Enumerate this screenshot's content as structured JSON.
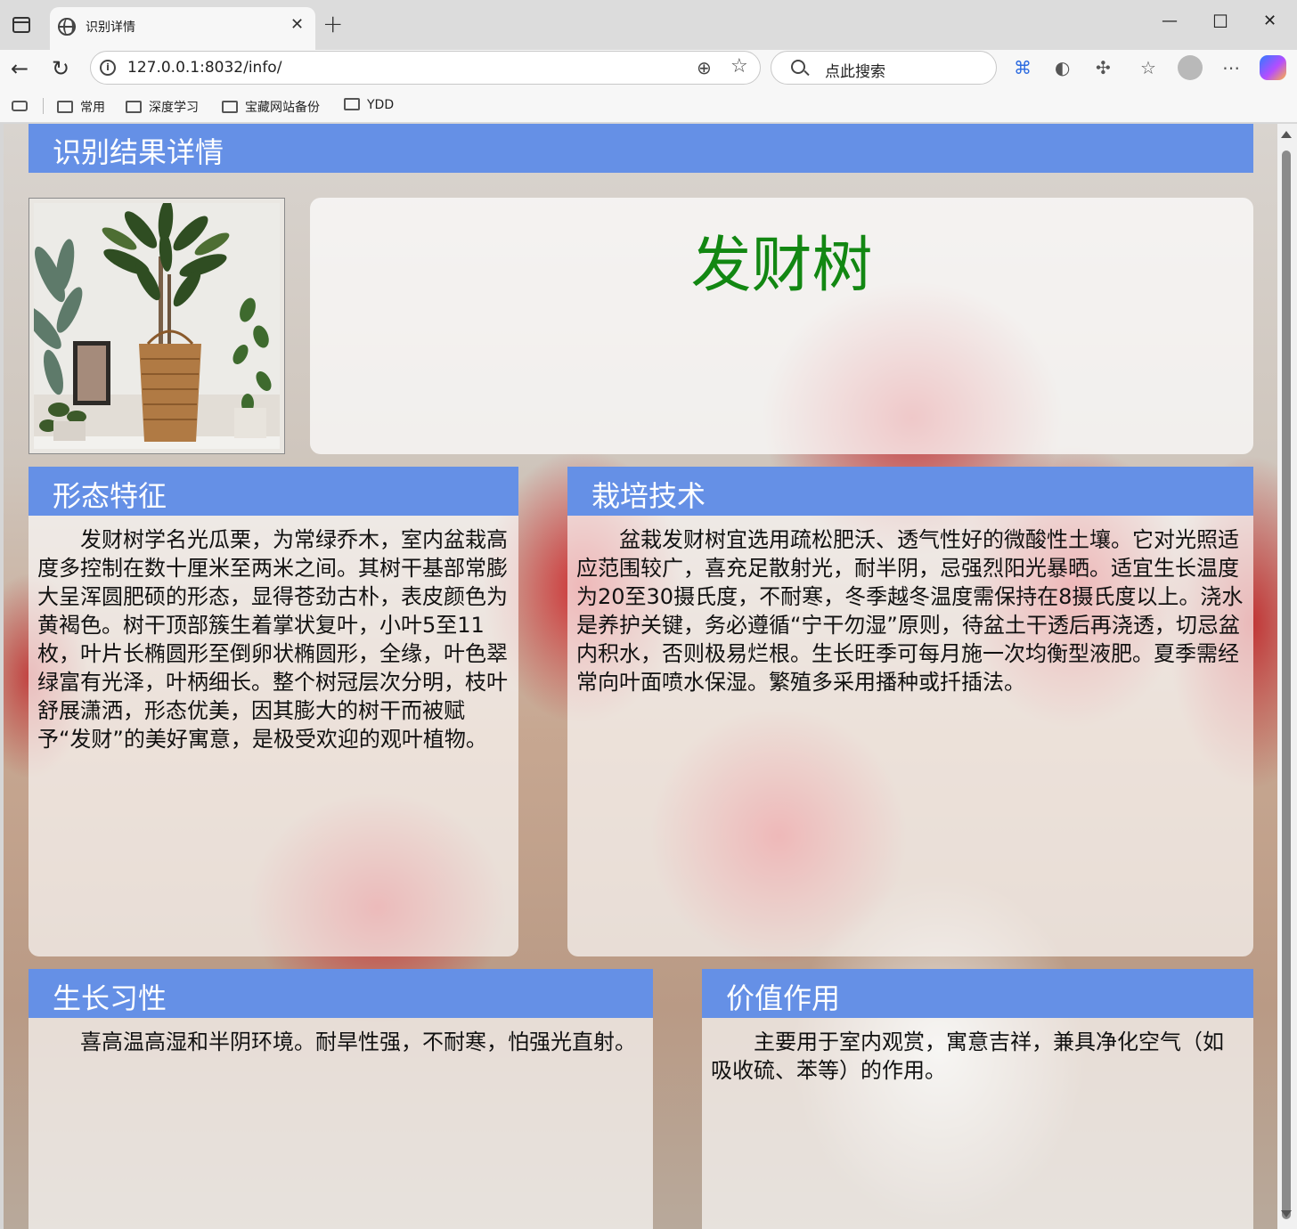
{
  "browser": {
    "tab_title": "识别详情",
    "url": "127.0.0.1:8032/info/",
    "search_placeholder": "点此搜索",
    "bookmarks": [
      "常用",
      "深度学习",
      "宝藏网站备份",
      "YDD"
    ]
  },
  "page": {
    "header_title": "识别结果详情",
    "plant_name": "发财树",
    "sections": {
      "morphology": {
        "title": "形态特征",
        "body": "发财树学名光瓜栗，为常绿乔木，室内盆栽高度多控制在数十厘米至两米之间。其树干基部常膨大呈浑圆肥硕的形态，显得苍劲古朴，表皮颜色为黄褐色。树干顶部簇生着掌状复叶，小叶5至11枚，叶片长椭圆形至倒卵状椭圆形，全缘，叶色翠绿富有光泽，叶柄细长。整个树冠层次分明，枝叶舒展潇洒，形态优美，因其膨大的树干而被赋予“发财”的美好寓意，是极受欢迎的观叶植物。"
      },
      "cultivation": {
        "title": "栽培技术",
        "body": "盆栽发财树宜选用疏松肥沃、透气性好的微酸性土壤。它对光照适应范围较广，喜充足散射光，耐半阴，忌强烈阳光暴晒。适宜生长温度为20至30摄氏度，不耐寒，冬季越冬温度需保持在8摄氏度以上。浇水是养护关键，务必遵循“宁干勿湿”原则，待盆土干透后再浇透，切忌盆内积水，否则极易烂根。生长旺季可每月施一次均衡型液肥。夏季需经常向叶面喷水保湿。繁殖多采用播种或扦插法。"
      },
      "habits": {
        "title": "生长习性",
        "body": "喜高温高湿和半阴环境。耐旱性强，不耐寒，怕强光直射。"
      },
      "value": {
        "title": "价值作用",
        "body": "主要用于室内观赏，寓意吉祥，兼具净化空气（如吸收硫、苯等）的作用。"
      }
    }
  },
  "colors": {
    "header_blue": "#6590e6",
    "plant_name_green": "#128712"
  }
}
